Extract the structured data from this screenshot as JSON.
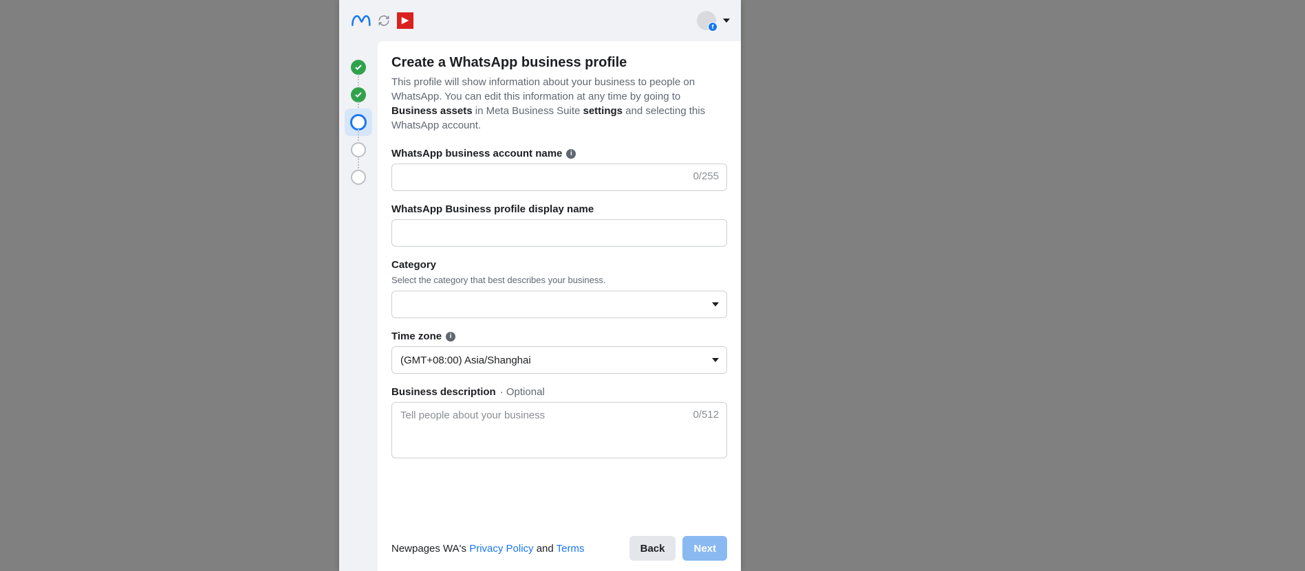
{
  "title": {
    "heading": "Create a WhatsApp business profile",
    "sub_part1": "This profile will show information about your business to people on WhatsApp. You can edit this information at any time by going to ",
    "sub_bold1": "Business assets",
    "sub_part2": " in Meta Business Suite ",
    "sub_bold2": "settings",
    "sub_part3": " and selecting this WhatsApp account."
  },
  "form": {
    "account_name": {
      "label": "WhatsApp business account name",
      "value": "",
      "counter": "0/255"
    },
    "display_name": {
      "label": "WhatsApp Business profile display name",
      "value": ""
    },
    "category": {
      "label": "Category",
      "help": "Select the category that best describes your business.",
      "value": ""
    },
    "timezone": {
      "label": "Time zone",
      "value": "(GMT+08:00) Asia/Shanghai"
    },
    "description": {
      "label": "Business description",
      "optional": " · Optional",
      "placeholder": "Tell people about your business",
      "value": "",
      "counter": "0/512"
    }
  },
  "footer": {
    "prefix": "Newpages WA's ",
    "privacy": "Privacy Policy",
    "and": " and ",
    "terms": "Terms",
    "back": "Back",
    "next": "Next"
  }
}
